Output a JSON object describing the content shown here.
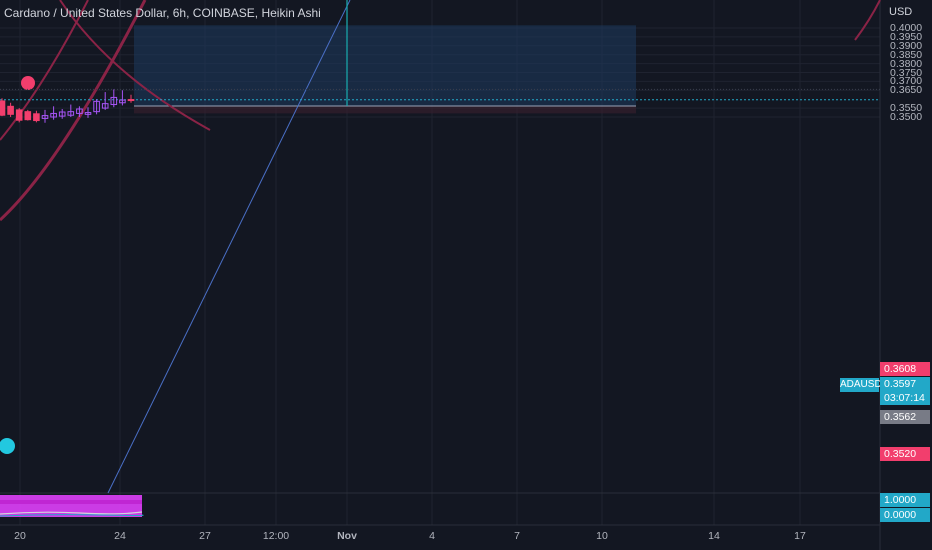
{
  "header": {
    "title": "Cardano / United States Dollar, 6h, COINBASE, Heikin Ashi",
    "currency": "USD"
  },
  "colors": {
    "background": "#131722",
    "up": "#a855f7",
    "down": "#f23e6d",
    "price_line": "#22a8c8",
    "zone": "#1e3a5f",
    "curve": "#8a2346",
    "indicator": "#e040fb"
  },
  "price_scale": {
    "ticks": [
      "0.4000",
      "0.3950",
      "0.3900",
      "0.3850",
      "0.3800",
      "0.3750",
      "0.3700",
      "0.3650",
      "0.3550",
      "0.3500"
    ],
    "labels": {
      "top_red": "0.3608",
      "symbol": "ADAUSD",
      "current": "0.3597",
      "countdown": "03:07:14",
      "gray": "0.3562",
      "bottom_red": "0.3520"
    }
  },
  "indicator_scale": {
    "top": "1.0000",
    "bottom": "0.0000"
  },
  "time_axis": {
    "ticks": [
      "20",
      "24",
      "27",
      "12:00",
      "Nov",
      "4",
      "7",
      "10",
      "14",
      "17"
    ]
  },
  "chart_data": {
    "type": "candlestick",
    "title": "Cardano / United States Dollar, 6h, COINBASE, Heikin Ashi",
    "ylabel": "USD",
    "ylim": [
      0.3468,
      0.402
    ],
    "current_price": 0.3597,
    "candles": [
      {
        "open": 0.359,
        "high": 0.3605,
        "low": 0.3505,
        "close": 0.351
      },
      {
        "open": 0.356,
        "high": 0.358,
        "low": 0.35,
        "close": 0.3515
      },
      {
        "open": 0.354,
        "high": 0.355,
        "low": 0.347,
        "close": 0.3482
      },
      {
        "open": 0.353,
        "high": 0.354,
        "low": 0.348,
        "close": 0.3485
      },
      {
        "open": 0.3518,
        "high": 0.3535,
        "low": 0.347,
        "close": 0.348
      },
      {
        "open": 0.3492,
        "high": 0.354,
        "low": 0.3468,
        "close": 0.3508
      },
      {
        "open": 0.35,
        "high": 0.356,
        "low": 0.3485,
        "close": 0.352
      },
      {
        "open": 0.3505,
        "high": 0.3545,
        "low": 0.349,
        "close": 0.3528
      },
      {
        "open": 0.351,
        "high": 0.357,
        "low": 0.35,
        "close": 0.353
      },
      {
        "open": 0.352,
        "high": 0.356,
        "low": 0.35,
        "close": 0.3545
      },
      {
        "open": 0.3515,
        "high": 0.3555,
        "low": 0.3495,
        "close": 0.3525
      },
      {
        "open": 0.353,
        "high": 0.36,
        "low": 0.3515,
        "close": 0.3588
      },
      {
        "open": 0.355,
        "high": 0.364,
        "low": 0.354,
        "close": 0.3575
      },
      {
        "open": 0.357,
        "high": 0.3655,
        "low": 0.3555,
        "close": 0.361
      },
      {
        "open": 0.358,
        "high": 0.365,
        "low": 0.3565,
        "close": 0.3595
      },
      {
        "open": 0.3598,
        "high": 0.3625,
        "low": 0.358,
        "close": 0.3597
      }
    ],
    "target_zone": {
      "top": 0.4015,
      "bottom": 0.3562
    },
    "stop_zone": {
      "top": 0.3562,
      "bottom": 0.352
    }
  }
}
